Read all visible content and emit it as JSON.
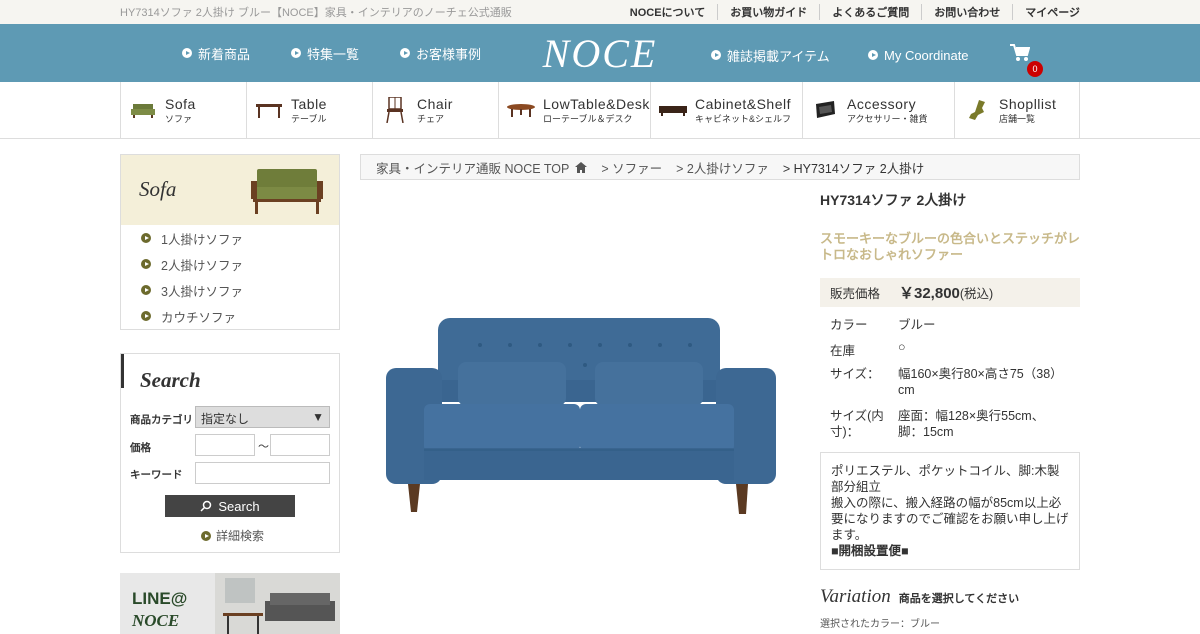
{
  "topbar": {
    "site_desc": "HY7314ソファ 2人掛け ブルー【NOCE】家具・インテリアのノーチェ公式通販",
    "links": [
      "NOCEについて",
      "お買い物ガイド",
      "よくあるご質問",
      "お問い合わせ",
      "マイページ"
    ]
  },
  "header": {
    "nav_left": [
      "新着商品",
      "特集一覧",
      "お客様事例"
    ],
    "logo": "NOCE",
    "nav_right": [
      "雑誌掲載アイテム",
      "My Coordinate"
    ],
    "cart_count": "0",
    "bg_color": "#5e9ab4"
  },
  "categories": [
    {
      "en": "Sofa",
      "ja": "ソファ",
      "icon": "sofa-icon"
    },
    {
      "en": "Table",
      "ja": "テーブル",
      "icon": "table-icon"
    },
    {
      "en": "Chair",
      "ja": "チェア",
      "icon": "chair-icon"
    },
    {
      "en": "LowTable&Desk",
      "ja": "ローテーブル＆デスク",
      "icon": "lowtable-icon"
    },
    {
      "en": "Cabinet&Shelf",
      "ja": "キャビネット&シェルフ",
      "icon": "cabinet-icon"
    },
    {
      "en": "Accessory",
      "ja": "アクセサリー・雑貨",
      "icon": "accessory-icon"
    },
    {
      "en": "Shopllist",
      "ja": "店舗一覧",
      "icon": "map-icon"
    }
  ],
  "sidebar": {
    "heading": "Sofa",
    "items": [
      "1人掛けソファ",
      "2人掛けソファ",
      "3人掛けソファ",
      "カウチソファ"
    ]
  },
  "search": {
    "heading": "Search",
    "category_label": "商品カテゴリ",
    "category_value": "指定なし",
    "price_label": "価格",
    "price_sep": "～",
    "keyword_label": "キーワード",
    "button": "Search",
    "advanced": "詳細検索"
  },
  "banner": {
    "line1": "LINE@",
    "line2": "NOCE"
  },
  "breadcrumb": [
    "家具・インテリア通販 NOCE TOP",
    "> ソファー",
    "> 2人掛けソファ",
    "> HY7314ソファ 2人掛け"
  ],
  "product": {
    "title": "HY7314ソファ 2人掛け",
    "catch": "スモーキーなブルーの色合いとステッチがレトロなおしゃれソファー",
    "price_label": "販売価格",
    "price": "￥32,800",
    "tax": "(税込)",
    "specs": [
      {
        "k": "カラー",
        "v": "ブルー"
      },
      {
        "k": "在庫",
        "v": "○"
      },
      {
        "k": "サイズ：",
        "v": "幅160×奥行80×高さ75（38）cm"
      },
      {
        "k": "サイズ(内寸)：",
        "v": "座面：幅128×奥行55cm、脚：15cm"
      }
    ],
    "desc": [
      "ポリエステル、ポケットコイル、脚:木製",
      "部分組立",
      "搬入の際に、搬入経路の幅が85cm以上必要になりますのでご確認をお願い申し上げます。",
      "■開梱設置便■"
    ],
    "variation": "Variation",
    "variation_note": "商品を選択してください",
    "selected_color": "選択されたカラー：ブルー"
  }
}
